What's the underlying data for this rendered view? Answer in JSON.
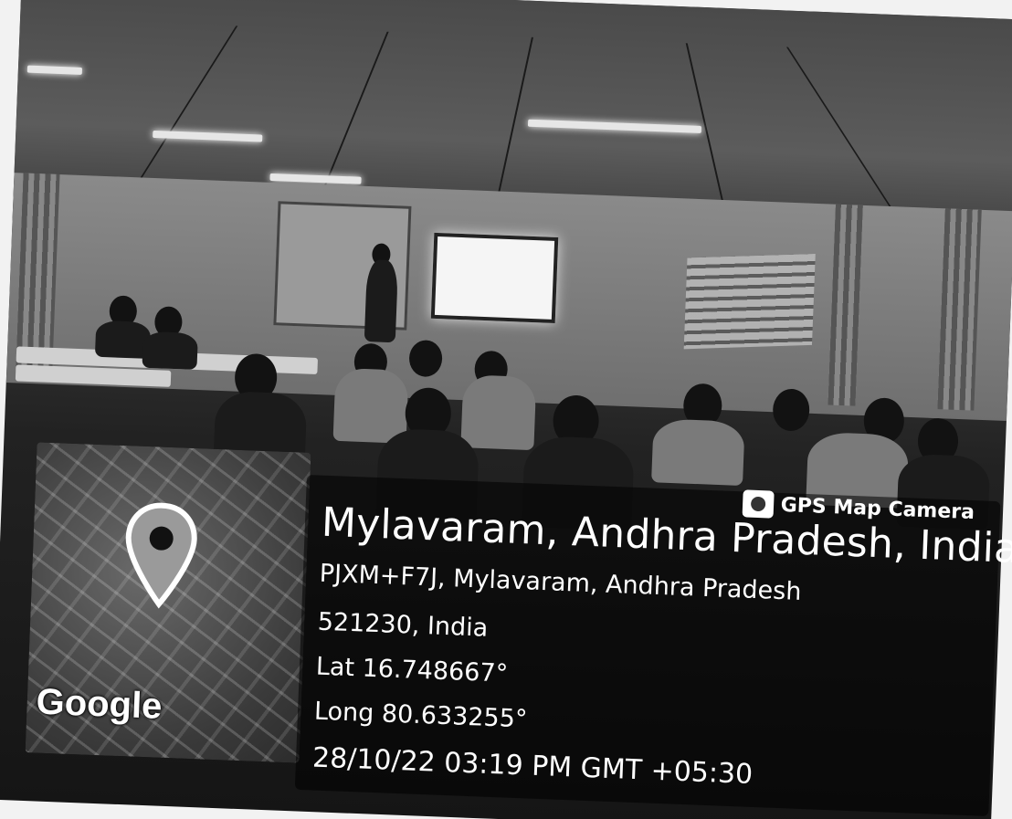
{
  "watermark": {
    "brand": "GPS Map Camera",
    "map_logo": "Google",
    "place_title": "Mylavaram, Andhra Pradesh, India",
    "address_line1": "PJXM+F7J, Mylavaram, Andhra Pradesh",
    "address_line2": "521230, India",
    "latitude": "Lat 16.748667°",
    "longitude": "Long 80.633255°",
    "datetime": "28/10/22 03:19 PM GMT +05:30"
  },
  "icons": {
    "camera": "camera-icon",
    "location": "map-pin-icon"
  },
  "colors": {
    "overlay_bg": "#000000",
    "text": "#ffffff"
  }
}
